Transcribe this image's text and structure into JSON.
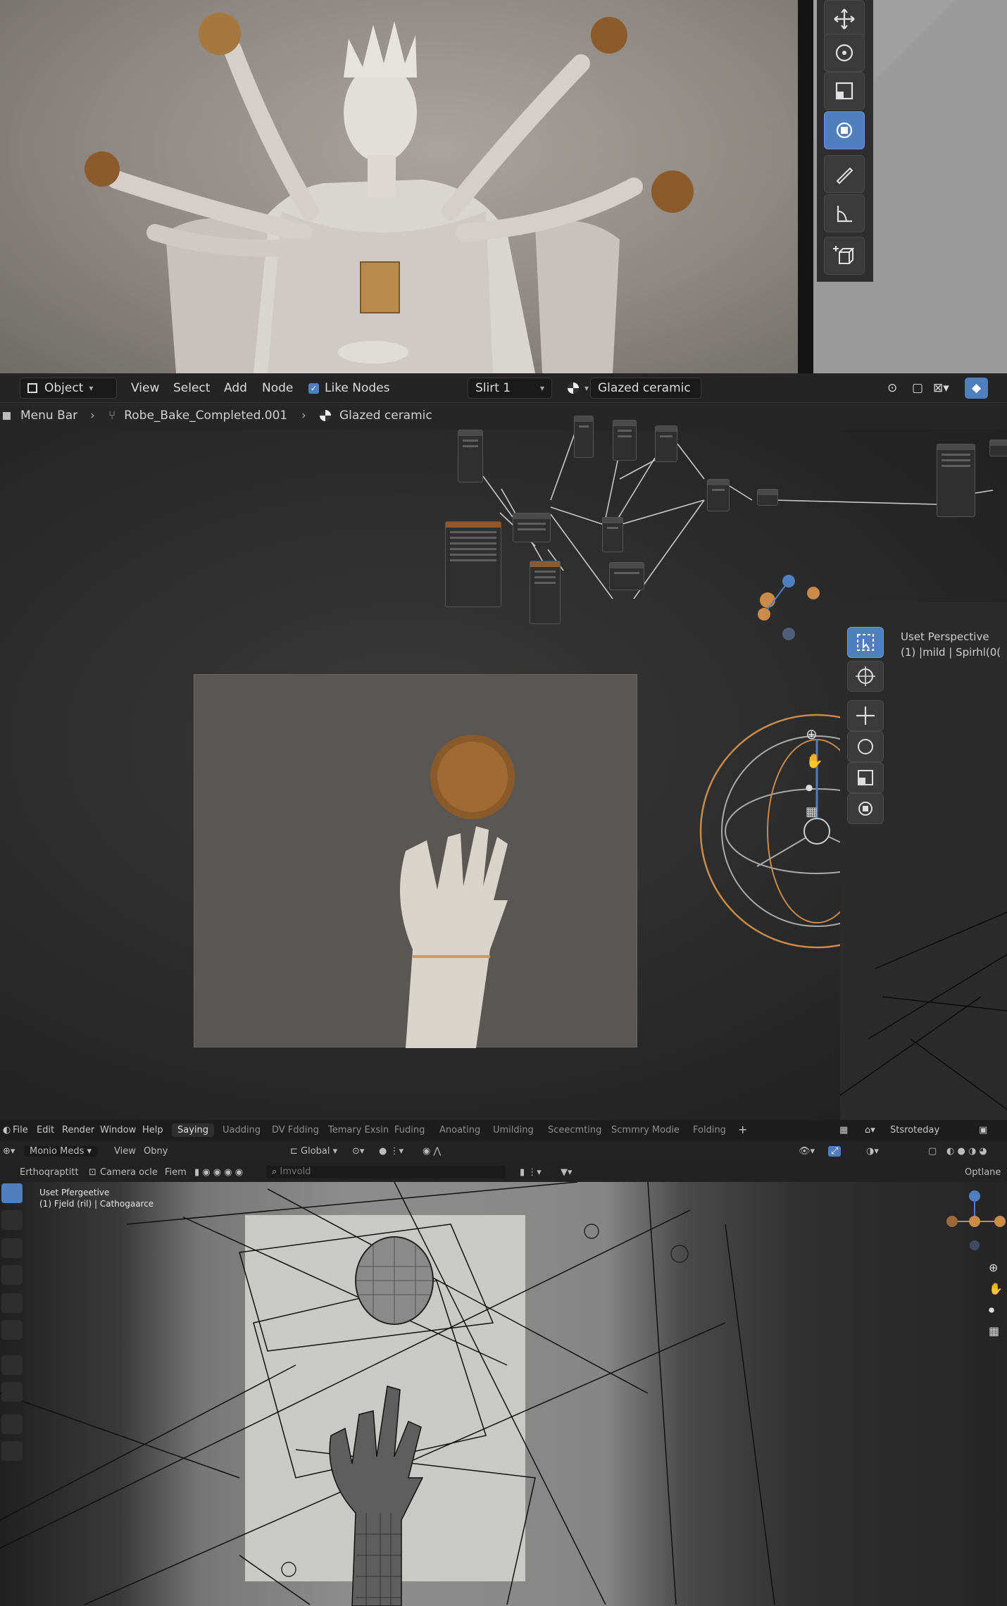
{
  "panel1": {
    "toolbar_icons": [
      "move-icon",
      "rotate-icon",
      "scale-icon",
      "transform-icon",
      "annotate-icon",
      "measure-icon",
      "add-cube-icon"
    ],
    "active_tool": "transform-icon"
  },
  "node_editor": {
    "header": {
      "editor_type": "Object",
      "menu": [
        "View",
        "Select",
        "Add",
        "Node"
      ],
      "checkbox_label": "Like Nodes",
      "slot": "Slirt 1",
      "material": "Glazed ceramic"
    },
    "breadcrumb": {
      "items": [
        "Menu Bar",
        "Robe_Bake_Completed.001",
        "Glazed ceramic"
      ]
    }
  },
  "viewport2": {
    "title": "Uset Perspective",
    "subtitle": "(1) |mild | Spirhl(0("
  },
  "viewport3": {
    "menubar": {
      "items": [
        "File",
        "Edit",
        "Render",
        "Window",
        "Help"
      ],
      "workspaces": [
        "Saying",
        "Uadding",
        "DV Fdding",
        "Temary Exsin",
        "Fuding",
        "Anoating",
        "Umilding",
        "Sceecmting",
        "Scmmry Modie",
        "Folding"
      ],
      "active_workspace": "Saying",
      "add": "+",
      "scene": "Stsroteday"
    },
    "header": {
      "mode": "Monio Meds",
      "menu": [
        "View",
        "Obny"
      ],
      "orientation": "Global",
      "overlay": "Optlane"
    },
    "subheader": {
      "view": "Erthoqraptitt",
      "camera": "Camera ocle",
      "fiem": "Fiem",
      "search_placeholder": "Imvold"
    },
    "title": "Uset Pfergeetive",
    "subtitle": "(1) Fjeld (ril) | Cathogaarce"
  },
  "colors": {
    "accent_blue": "#4f7fbf",
    "gizmo_orange": "#c98a4a",
    "panel_dark": "#262626"
  }
}
